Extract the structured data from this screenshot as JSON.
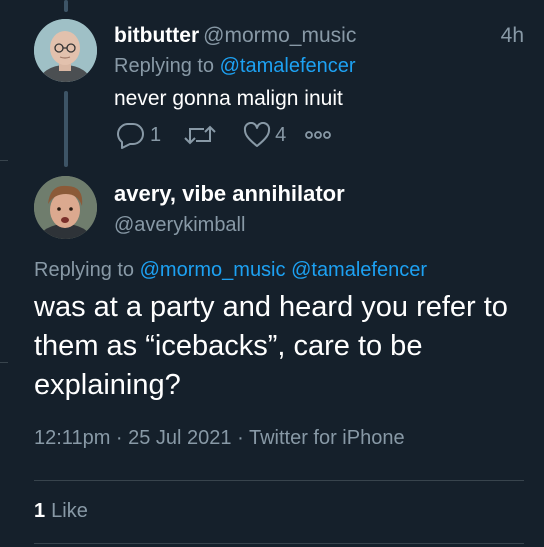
{
  "tweet1": {
    "display_name": "bitbutter",
    "handle": "@mormo_music",
    "time": "4h",
    "replying_prefix": "Replying to",
    "replying_to": "@tamalefencer",
    "text": "never gonna malign inuit",
    "reply_count": "1",
    "like_count": "4"
  },
  "tweet2": {
    "display_name": "avery, vibe annihilator",
    "handle": "@averykimball",
    "replying_prefix": "Replying to",
    "replying_to_1": "@mormo_music",
    "replying_to_2": "@tamalefencer",
    "text": "was at a party and heard you refer to them as “icebacks”, care to be explaining?",
    "timestamp": "12:11pm · 25 Jul 2021 · Twitter for iPhone",
    "likes_count": "1",
    "likes_label": "Like"
  },
  "colors": {
    "background": "#15202b",
    "secondary_text": "#8899a6",
    "link": "#1da1f2",
    "divider": "#38444d"
  },
  "icons": [
    "reply-icon",
    "retweet-icon",
    "like-icon",
    "more-icon"
  ]
}
